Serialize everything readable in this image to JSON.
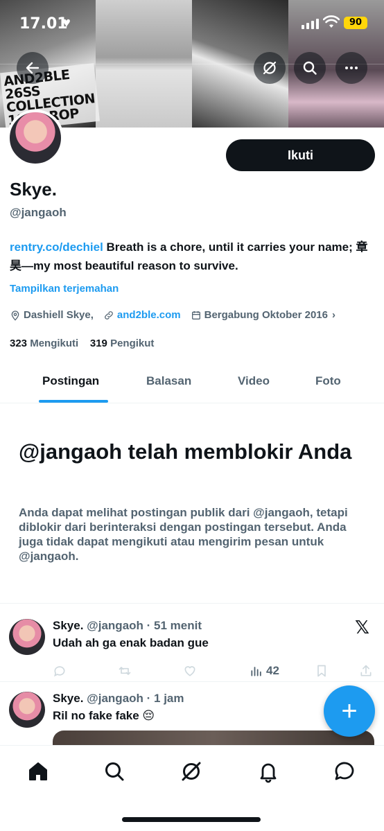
{
  "status_bar": {
    "time": "17.01",
    "battery": "90"
  },
  "banner": {
    "text_lines": [
      "AND2BLE 26SS",
      "COLLECTION",
      "1ST DROP"
    ]
  },
  "profile": {
    "name": "Skye.",
    "handle": "@jangaoh",
    "follow_label": "Ikuti",
    "bio_link": "rentry.co/dechiel",
    "bio_text": "Breath is a chore, until it carries your name; 章昊—my most beautiful reason to survive.",
    "translate_label": "Tampilkan terjemahan",
    "location": "Dashiell Skye,",
    "website": "and2ble.com",
    "joined": "Bergabung Oktober 2016",
    "following_count": "323",
    "following_label": "Mengikuti",
    "followers_count": "319",
    "followers_label": "Pengikut"
  },
  "tabs": [
    {
      "label": "Postingan",
      "active": true
    },
    {
      "label": "Balasan",
      "active": false
    },
    {
      "label": "Video",
      "active": false
    },
    {
      "label": "Foto",
      "active": false
    }
  ],
  "block_notice": {
    "title": "@jangaoh telah memblokir Anda",
    "text": "Anda dapat melihat postingan publik dari @jangaoh, tetapi diblokir dari berinteraksi dengan postingan tersebut. Anda juga tidak dapat mengikuti atau mengirim pesan untuk @jangaoh."
  },
  "posts": [
    {
      "name": "Skye.",
      "meta": "@jangaoh · 51 menit",
      "text": "Udah ah ga enak badan gue",
      "views": "42"
    },
    {
      "name": "Skye.",
      "meta": "@jangaoh · 1 jam",
      "text": "Ril no fake fake 😔"
    }
  ],
  "fab": {
    "label": "+"
  },
  "colors": {
    "accent": "#1d9bf0",
    "text": "#0f1419",
    "muted": "#536471"
  }
}
